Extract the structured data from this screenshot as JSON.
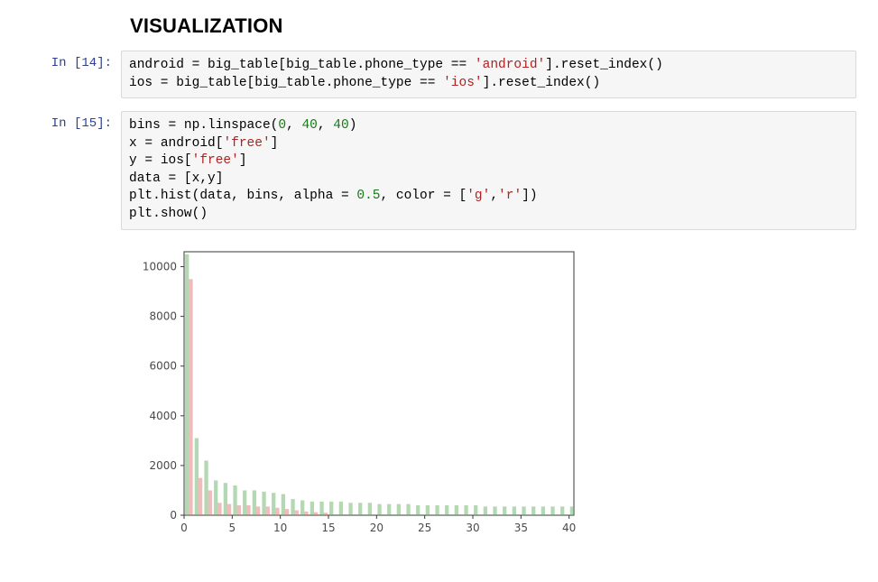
{
  "heading": "VISUALIZATION",
  "cells": [
    {
      "prompt_label": "In [14]:",
      "prompt_num": "14",
      "code_tokens": [
        [
          {
            "t": "id",
            "v": "android"
          },
          {
            "t": "op",
            "v": " = "
          },
          {
            "t": "id",
            "v": "big_table"
          },
          {
            "t": "pun",
            "v": "["
          },
          {
            "t": "id",
            "v": "big_table"
          },
          {
            "t": "pun",
            "v": "."
          },
          {
            "t": "id",
            "v": "phone_type"
          },
          {
            "t": "op",
            "v": " == "
          },
          {
            "t": "str",
            "v": "'android'"
          },
          {
            "t": "pun",
            "v": "]"
          },
          {
            "t": "pun",
            "v": "."
          },
          {
            "t": "call",
            "v": "reset_index"
          },
          {
            "t": "pun",
            "v": "()"
          }
        ],
        [
          {
            "t": "id",
            "v": "ios"
          },
          {
            "t": "op",
            "v": " = "
          },
          {
            "t": "id",
            "v": "big_table"
          },
          {
            "t": "pun",
            "v": "["
          },
          {
            "t": "id",
            "v": "big_table"
          },
          {
            "t": "pun",
            "v": "."
          },
          {
            "t": "id",
            "v": "phone_type"
          },
          {
            "t": "op",
            "v": " == "
          },
          {
            "t": "str",
            "v": "'ios'"
          },
          {
            "t": "pun",
            "v": "]"
          },
          {
            "t": "pun",
            "v": "."
          },
          {
            "t": "call",
            "v": "reset_index"
          },
          {
            "t": "pun",
            "v": "()"
          }
        ]
      ]
    },
    {
      "prompt_label": "In [15]:",
      "prompt_num": "15",
      "code_tokens": [
        [
          {
            "t": "id",
            "v": "bins"
          },
          {
            "t": "op",
            "v": " = "
          },
          {
            "t": "id",
            "v": "np"
          },
          {
            "t": "pun",
            "v": "."
          },
          {
            "t": "call",
            "v": "linspace"
          },
          {
            "t": "pun",
            "v": "("
          },
          {
            "t": "num",
            "v": "0"
          },
          {
            "t": "pun",
            "v": ", "
          },
          {
            "t": "num",
            "v": "40"
          },
          {
            "t": "pun",
            "v": ", "
          },
          {
            "t": "num",
            "v": "40"
          },
          {
            "t": "pun",
            "v": ")"
          }
        ],
        [
          {
            "t": "id",
            "v": "x"
          },
          {
            "t": "op",
            "v": " = "
          },
          {
            "t": "id",
            "v": "android"
          },
          {
            "t": "pun",
            "v": "["
          },
          {
            "t": "str",
            "v": "'free'"
          },
          {
            "t": "pun",
            "v": "]"
          }
        ],
        [
          {
            "t": "id",
            "v": "y"
          },
          {
            "t": "op",
            "v": " = "
          },
          {
            "t": "id",
            "v": "ios"
          },
          {
            "t": "pun",
            "v": "["
          },
          {
            "t": "str",
            "v": "'free'"
          },
          {
            "t": "pun",
            "v": "]"
          }
        ],
        [
          {
            "t": "id",
            "v": "data"
          },
          {
            "t": "op",
            "v": " = "
          },
          {
            "t": "pun",
            "v": "["
          },
          {
            "t": "id",
            "v": "x"
          },
          {
            "t": "pun",
            "v": ","
          },
          {
            "t": "id",
            "v": "y"
          },
          {
            "t": "pun",
            "v": "]"
          }
        ],
        [
          {
            "t": "id",
            "v": "plt"
          },
          {
            "t": "pun",
            "v": "."
          },
          {
            "t": "call",
            "v": "hist"
          },
          {
            "t": "pun",
            "v": "("
          },
          {
            "t": "id",
            "v": "data"
          },
          {
            "t": "pun",
            "v": ", "
          },
          {
            "t": "id",
            "v": "bins"
          },
          {
            "t": "pun",
            "v": ", "
          },
          {
            "t": "id",
            "v": "alpha"
          },
          {
            "t": "op",
            "v": " = "
          },
          {
            "t": "num",
            "v": "0.5"
          },
          {
            "t": "pun",
            "v": ", "
          },
          {
            "t": "id",
            "v": "color"
          },
          {
            "t": "op",
            "v": " = "
          },
          {
            "t": "pun",
            "v": "["
          },
          {
            "t": "str",
            "v": "'g'"
          },
          {
            "t": "pun",
            "v": ","
          },
          {
            "t": "str",
            "v": "'r'"
          },
          {
            "t": "pun",
            "v": "])"
          }
        ],
        [
          {
            "t": "id",
            "v": "plt"
          },
          {
            "t": "pun",
            "v": "."
          },
          {
            "t": "call",
            "v": "show"
          },
          {
            "t": "pun",
            "v": "()"
          }
        ]
      ]
    }
  ],
  "chart_data": {
    "type": "bar",
    "title": "",
    "xlabel": "",
    "ylabel": "",
    "xlim": [
      0,
      40.5
    ],
    "ylim": [
      0,
      10600
    ],
    "xticks": [
      0,
      5,
      10,
      15,
      20,
      25,
      30,
      35,
      40
    ],
    "yticks": [
      0,
      2000,
      4000,
      6000,
      8000,
      10000
    ],
    "categories": [
      0,
      1,
      2,
      3,
      4,
      5,
      6,
      7,
      8,
      9,
      10,
      11,
      12,
      13,
      14,
      15,
      16,
      17,
      18,
      19,
      20,
      21,
      22,
      23,
      24,
      25,
      26,
      27,
      28,
      29,
      30,
      31,
      32,
      33,
      34,
      35,
      36,
      37,
      38,
      39,
      40
    ],
    "series": [
      {
        "name": "android",
        "color": "#69b06a",
        "values": [
          10500,
          3100,
          2200,
          1400,
          1300,
          1200,
          1000,
          1000,
          950,
          900,
          850,
          650,
          600,
          550,
          550,
          550,
          550,
          500,
          500,
          500,
          450,
          450,
          450,
          450,
          400,
          400,
          400,
          400,
          400,
          400,
          400,
          350,
          350,
          350,
          350,
          350,
          350,
          350,
          350,
          350,
          350
        ]
      },
      {
        "name": "ios",
        "color": "#e07a78",
        "values": [
          9500,
          1500,
          1000,
          500,
          450,
          400,
          400,
          350,
          350,
          300,
          250,
          200,
          150,
          120,
          100,
          0,
          0,
          0,
          0,
          0,
          0,
          0,
          0,
          0,
          0,
          0,
          0,
          0,
          0,
          0,
          0,
          0,
          0,
          0,
          0,
          0,
          0,
          0,
          0,
          0,
          0
        ]
      }
    ],
    "alpha": 0.5,
    "bins": 40
  }
}
